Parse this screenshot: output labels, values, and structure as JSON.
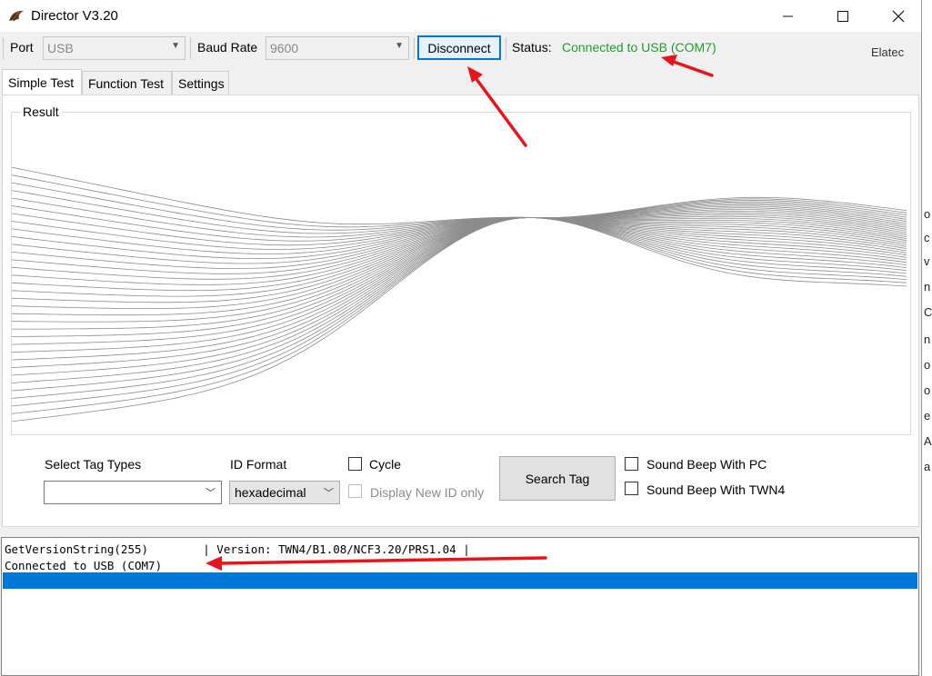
{
  "window": {
    "title": "Director V3.20",
    "icon": "app-icon"
  },
  "toolbar": {
    "port_label": "Port",
    "port_value": "USB",
    "baud_label": "Baud Rate",
    "baud_value": "9600",
    "disconnect_label": "Disconnect",
    "status_label": "Status:",
    "status_value": "Connected to USB (COM7)",
    "brand": "Elatec"
  },
  "tabs": [
    "Simple Test",
    "Function Test",
    "Settings"
  ],
  "result": {
    "title": "Result"
  },
  "controls": {
    "select_tag_types_label": "Select Tag Types",
    "select_tag_types_value": "",
    "id_format_label": "ID Format",
    "id_format_value": "hexadecimal",
    "cycle_label": "Cycle",
    "display_new_id_label": "Display New ID only",
    "search_tag_label": "Search Tag",
    "sound_beep_pc_label": "Sound Beep With PC",
    "sound_beep_twn4_label": "Sound Beep With TWN4"
  },
  "log": {
    "lines": [
      "GetVersionString(255)        | Version: TWN4/B1.08/NCF3.20/PRS1.04 |",
      "Connected to USB (COM7)"
    ]
  },
  "colors": {
    "status_green": "#1e9e2c",
    "selection_blue": "#0078d7",
    "annotation_red": "#e8141a"
  },
  "right_strip": [
    "o",
    "c",
    "v",
    "n",
    "C",
    "n",
    "o",
    "o",
    "e",
    "A",
    "a"
  ]
}
